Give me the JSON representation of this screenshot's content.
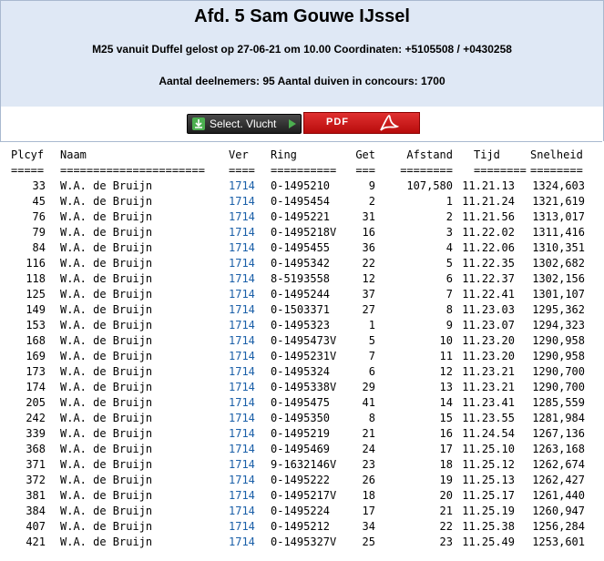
{
  "header": {
    "title": "Afd. 5 Sam Gouwe IJssel",
    "flight_info": "M25 vanuit Duffel gelost op 27-06-21 om 10.00 Coordinaten: +5105508 / +0430258",
    "participants": "Aantal deelnemers: 95 Aantal duiven in concours: 1700"
  },
  "buttons": {
    "select_flight": "Select. Vlucht",
    "pdf": "PDF"
  },
  "columns": {
    "plaats": "Plcyf",
    "naam": "Naam",
    "ver": "Ver",
    "ring": "Ring",
    "get": "Get",
    "afstand": "Afstand",
    "tijd": "Tijd",
    "snelheid": "Snelheid"
  },
  "separators": {
    "plaats": "=====",
    "naam": "======================",
    "ver": "====",
    "ring": "==========",
    "get": "===",
    "afstand": "========",
    "tijd": "========",
    "snelheid": "========"
  },
  "rows": [
    {
      "plaats": "33",
      "naam": "W.A. de Bruijn",
      "ver": "1714",
      "ring": "0-1495210",
      "get": "9",
      "afstand": "107,580",
      "tijd": "11.21.13",
      "snelheid": "1324,603"
    },
    {
      "plaats": "45",
      "naam": "W.A. de Bruijn",
      "ver": "1714",
      "ring": "0-1495454",
      "get": "2",
      "afstand": "1",
      "tijd": "11.21.24",
      "snelheid": "1321,619"
    },
    {
      "plaats": "76",
      "naam": "W.A. de Bruijn",
      "ver": "1714",
      "ring": "0-1495221",
      "get": "31",
      "afstand": "2",
      "tijd": "11.21.56",
      "snelheid": "1313,017"
    },
    {
      "plaats": "79",
      "naam": "W.A. de Bruijn",
      "ver": "1714",
      "ring": "0-1495218V",
      "get": "16",
      "afstand": "3",
      "tijd": "11.22.02",
      "snelheid": "1311,416"
    },
    {
      "plaats": "84",
      "naam": "W.A. de Bruijn",
      "ver": "1714",
      "ring": "0-1495455",
      "get": "36",
      "afstand": "4",
      "tijd": "11.22.06",
      "snelheid": "1310,351"
    },
    {
      "plaats": "116",
      "naam": "W.A. de Bruijn",
      "ver": "1714",
      "ring": "0-1495342",
      "get": "22",
      "afstand": "5",
      "tijd": "11.22.35",
      "snelheid": "1302,682"
    },
    {
      "plaats": "118",
      "naam": "W.A. de Bruijn",
      "ver": "1714",
      "ring": "8-5193558",
      "get": "12",
      "afstand": "6",
      "tijd": "11.22.37",
      "snelheid": "1302,156"
    },
    {
      "plaats": "125",
      "naam": "W.A. de Bruijn",
      "ver": "1714",
      "ring": "0-1495244",
      "get": "37",
      "afstand": "7",
      "tijd": "11.22.41",
      "snelheid": "1301,107"
    },
    {
      "plaats": "149",
      "naam": "W.A. de Bruijn",
      "ver": "1714",
      "ring": "0-1503371",
      "get": "27",
      "afstand": "8",
      "tijd": "11.23.03",
      "snelheid": "1295,362"
    },
    {
      "plaats": "153",
      "naam": "W.A. de Bruijn",
      "ver": "1714",
      "ring": "0-1495323",
      "get": "1",
      "afstand": "9",
      "tijd": "11.23.07",
      "snelheid": "1294,323"
    },
    {
      "plaats": "168",
      "naam": "W.A. de Bruijn",
      "ver": "1714",
      "ring": "0-1495473V",
      "get": "5",
      "afstand": "10",
      "tijd": "11.23.20",
      "snelheid": "1290,958"
    },
    {
      "plaats": "169",
      "naam": "W.A. de Bruijn",
      "ver": "1714",
      "ring": "0-1495231V",
      "get": "7",
      "afstand": "11",
      "tijd": "11.23.20",
      "snelheid": "1290,958"
    },
    {
      "plaats": "173",
      "naam": "W.A. de Bruijn",
      "ver": "1714",
      "ring": "0-1495324",
      "get": "6",
      "afstand": "12",
      "tijd": "11.23.21",
      "snelheid": "1290,700"
    },
    {
      "plaats": "174",
      "naam": "W.A. de Bruijn",
      "ver": "1714",
      "ring": "0-1495338V",
      "get": "29",
      "afstand": "13",
      "tijd": "11.23.21",
      "snelheid": "1290,700"
    },
    {
      "plaats": "205",
      "naam": "W.A. de Bruijn",
      "ver": "1714",
      "ring": "0-1495475",
      "get": "41",
      "afstand": "14",
      "tijd": "11.23.41",
      "snelheid": "1285,559"
    },
    {
      "plaats": "242",
      "naam": "W.A. de Bruijn",
      "ver": "1714",
      "ring": "0-1495350",
      "get": "8",
      "afstand": "15",
      "tijd": "11.23.55",
      "snelheid": "1281,984"
    },
    {
      "plaats": "339",
      "naam": "W.A. de Bruijn",
      "ver": "1714",
      "ring": "0-1495219",
      "get": "21",
      "afstand": "16",
      "tijd": "11.24.54",
      "snelheid": "1267,136"
    },
    {
      "plaats": "368",
      "naam": "W.A. de Bruijn",
      "ver": "1714",
      "ring": "0-1495469",
      "get": "24",
      "afstand": "17",
      "tijd": "11.25.10",
      "snelheid": "1263,168"
    },
    {
      "plaats": "371",
      "naam": "W.A. de Bruijn",
      "ver": "1714",
      "ring": "9-1632146V",
      "get": "23",
      "afstand": "18",
      "tijd": "11.25.12",
      "snelheid": "1262,674"
    },
    {
      "plaats": "372",
      "naam": "W.A. de Bruijn",
      "ver": "1714",
      "ring": "0-1495222",
      "get": "26",
      "afstand": "19",
      "tijd": "11.25.13",
      "snelheid": "1262,427"
    },
    {
      "plaats": "381",
      "naam": "W.A. de Bruijn",
      "ver": "1714",
      "ring": "0-1495217V",
      "get": "18",
      "afstand": "20",
      "tijd": "11.25.17",
      "snelheid": "1261,440"
    },
    {
      "plaats": "384",
      "naam": "W.A. de Bruijn",
      "ver": "1714",
      "ring": "0-1495224",
      "get": "17",
      "afstand": "21",
      "tijd": "11.25.19",
      "snelheid": "1260,947"
    },
    {
      "plaats": "407",
      "naam": "W.A. de Bruijn",
      "ver": "1714",
      "ring": "0-1495212",
      "get": "34",
      "afstand": "22",
      "tijd": "11.25.38",
      "snelheid": "1256,284"
    },
    {
      "plaats": "421",
      "naam": "W.A. de Bruijn",
      "ver": "1714",
      "ring": "0-1495327V",
      "get": "25",
      "afstand": "23",
      "tijd": "11.25.49",
      "snelheid": "1253,601"
    }
  ]
}
